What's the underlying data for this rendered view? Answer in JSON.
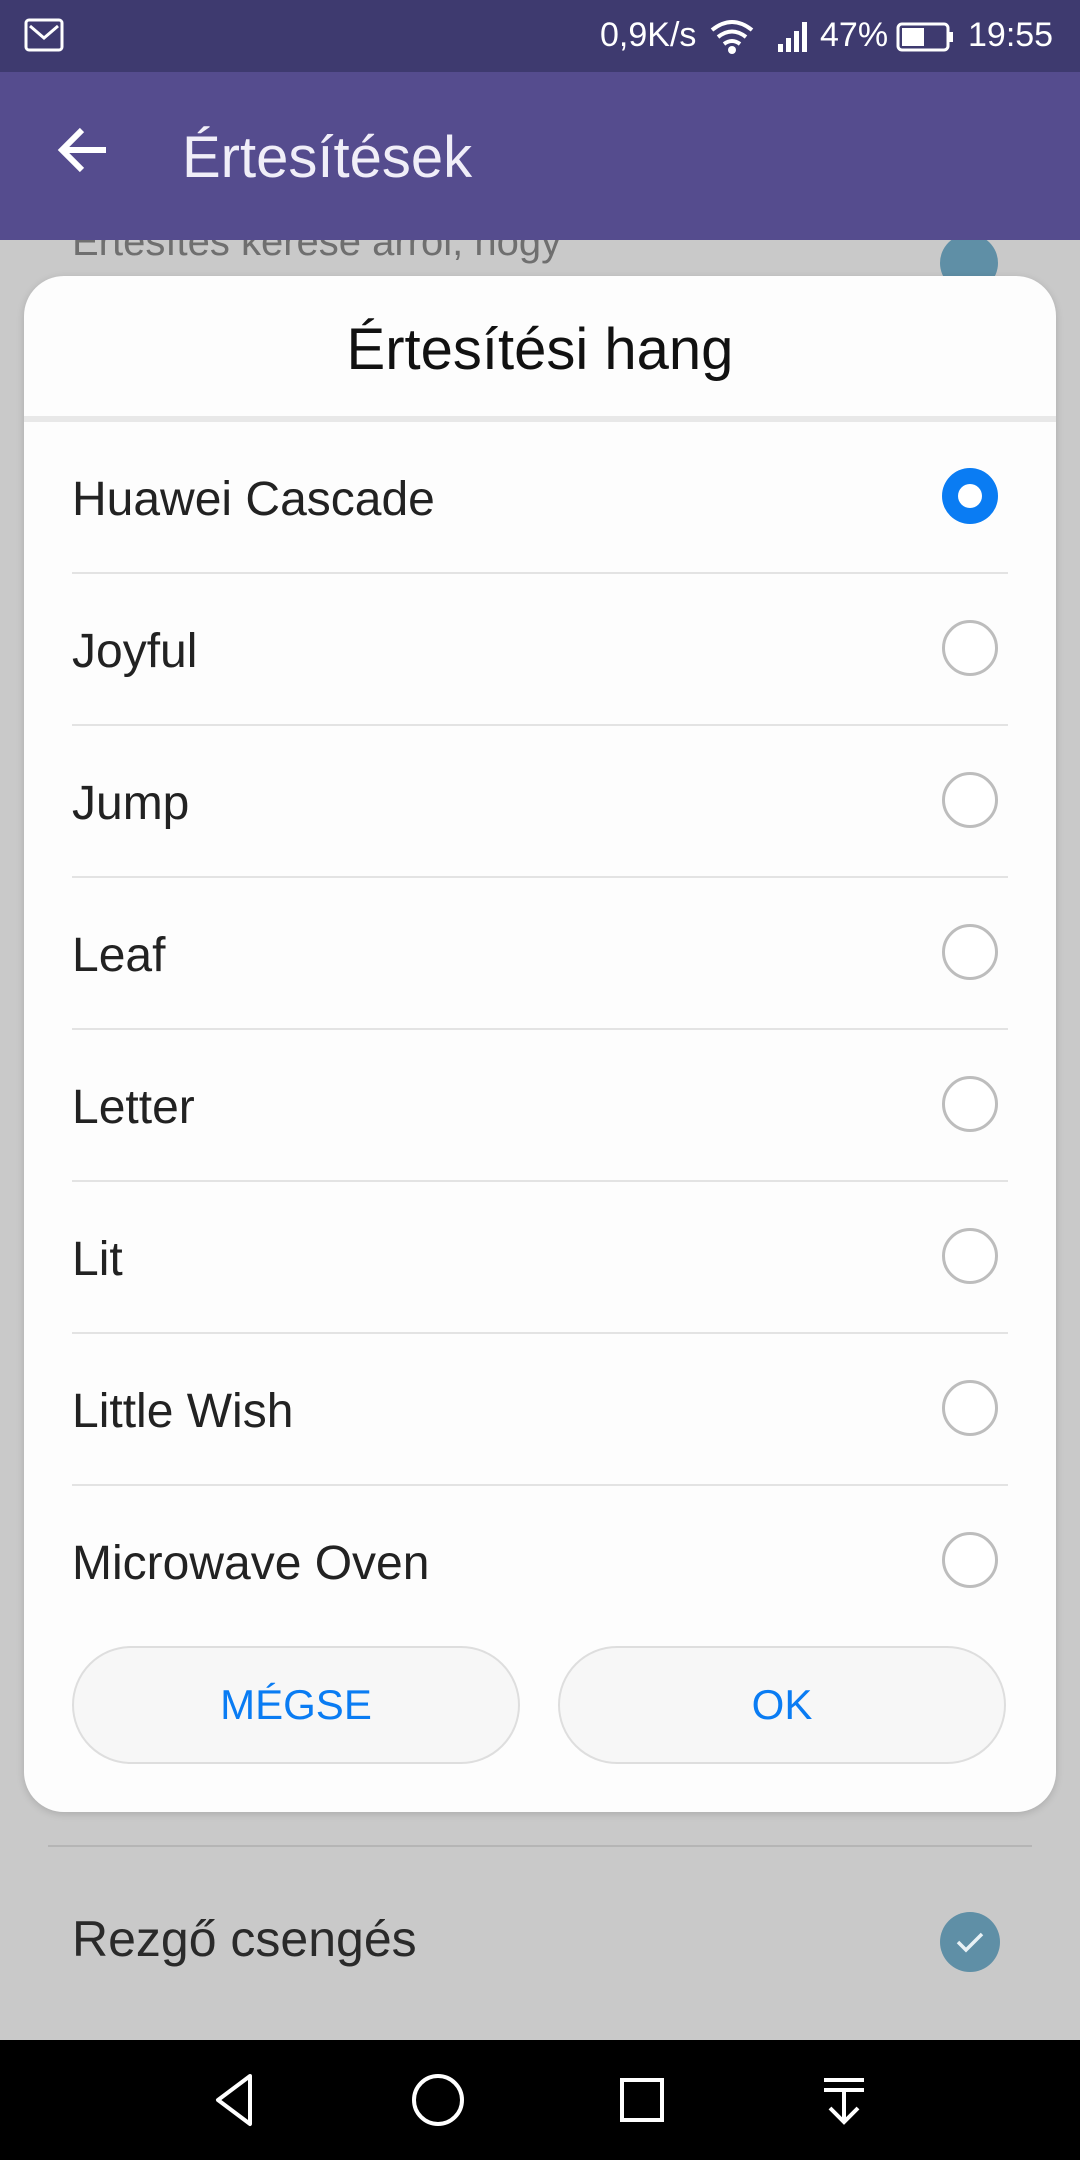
{
  "status_bar": {
    "net_speed": "0,9K/s",
    "battery_percent": "47%",
    "time": "19:55",
    "icons": [
      "mail-icon",
      "wifi-icon",
      "signal-icon",
      "battery-icon"
    ]
  },
  "app_bar": {
    "title": "Értesítések",
    "back_icon": "back-arrow-icon"
  },
  "background": {
    "partial_row_text": "Értesítés kérése arról, hogy",
    "vibrate_label": "Rezgő csengés",
    "vibrate_checked": true
  },
  "dialog": {
    "title": "Értesítési hang",
    "options": [
      {
        "label": "Huawei Cascade",
        "selected": true
      },
      {
        "label": "Joyful",
        "selected": false
      },
      {
        "label": "Jump",
        "selected": false
      },
      {
        "label": "Leaf",
        "selected": false
      },
      {
        "label": "Letter",
        "selected": false
      },
      {
        "label": "Lit",
        "selected": false
      },
      {
        "label": "Little Wish",
        "selected": false
      },
      {
        "label": "Microwave Oven",
        "selected": false
      }
    ],
    "cancel_label": "MÉGSE",
    "ok_label": "OK"
  },
  "nav_bar": {
    "icons": [
      "back-triangle-icon",
      "home-circle-icon",
      "recents-square-icon",
      "notification-pulldown-icon"
    ]
  },
  "colors": {
    "status_bar": "#3e3a6f",
    "app_bar": "#554c8e",
    "accent": "#0a7cf3",
    "checkbox": "#5f8fa6"
  }
}
